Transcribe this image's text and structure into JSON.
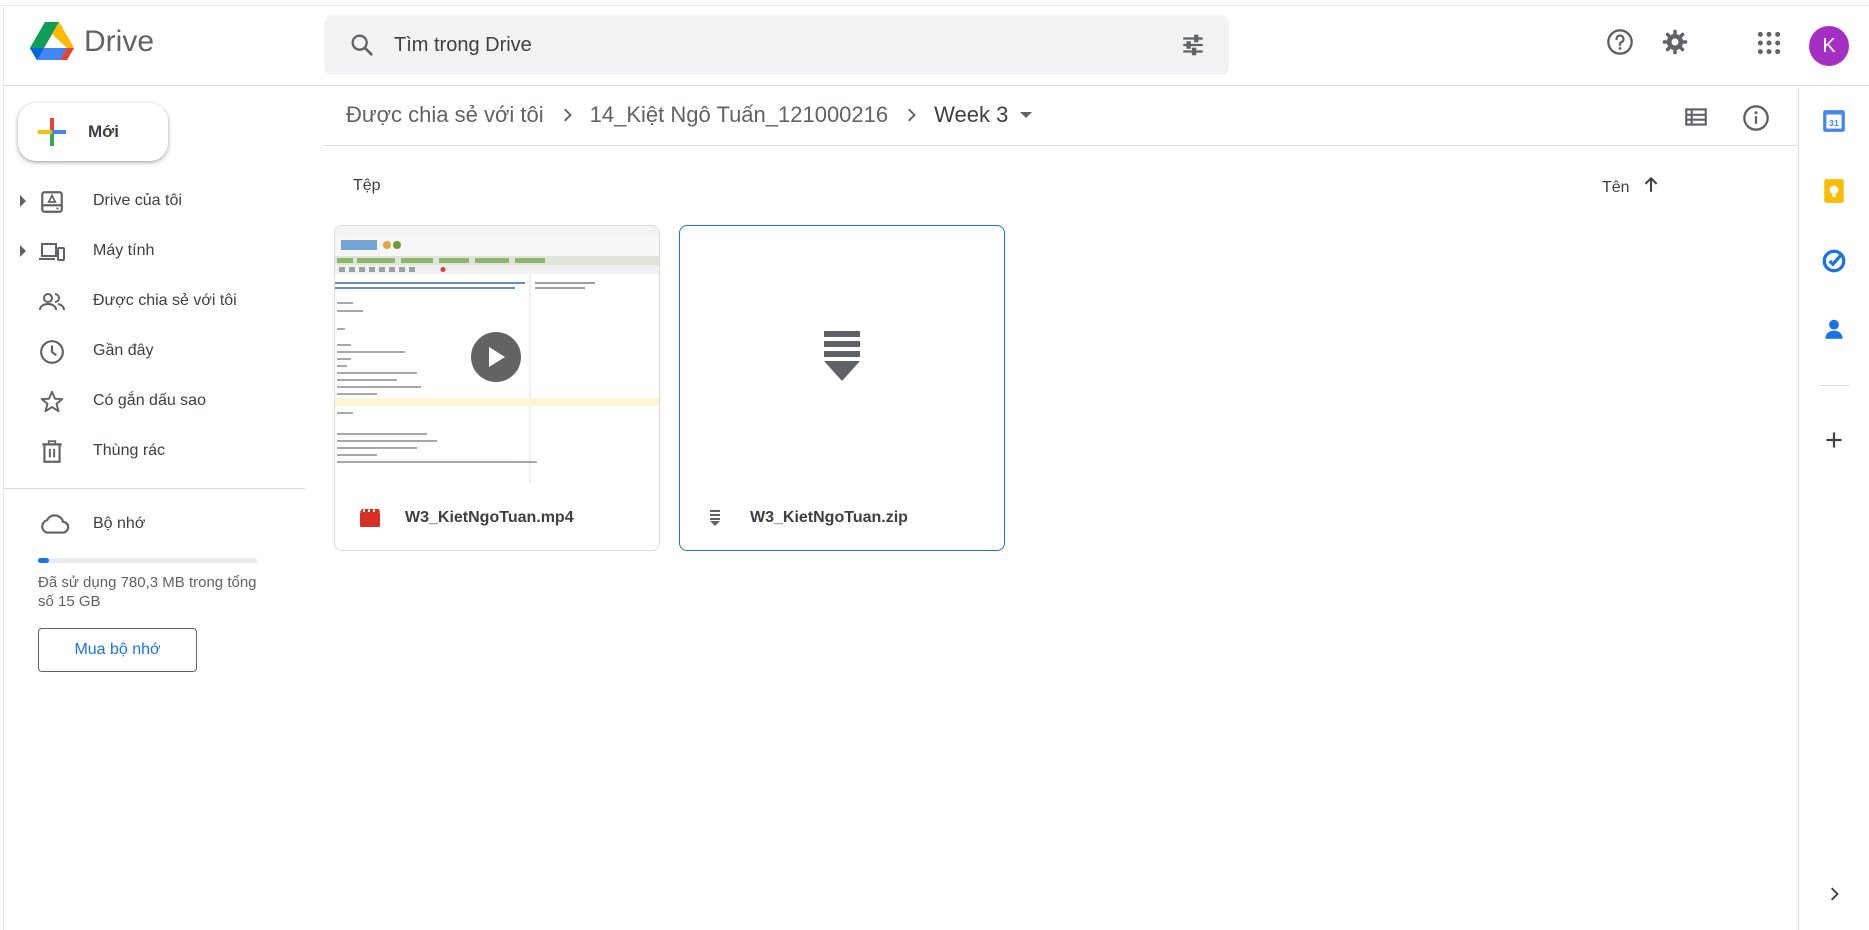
{
  "app": {
    "name": "Drive"
  },
  "search": {
    "placeholder": "Tìm trong Drive"
  },
  "header": {
    "avatar_letter": "K",
    "avatar_color": "#a42fc2"
  },
  "sidebar": {
    "new_label": "Mới",
    "items": [
      {
        "label": "Drive của tôi",
        "icon": "my-drive-icon",
        "expandable": true
      },
      {
        "label": "Máy tính",
        "icon": "computers-icon",
        "expandable": true
      },
      {
        "label": "Được chia sẻ với tôi",
        "icon": "shared-people-icon",
        "expandable": false
      },
      {
        "label": "Gần đây",
        "icon": "clock-icon",
        "expandable": false
      },
      {
        "label": "Có gắn dấu sao",
        "icon": "star-icon",
        "expandable": false
      },
      {
        "label": "Thùng rác",
        "icon": "trash-icon",
        "expandable": false
      }
    ],
    "storage": {
      "label": "Bộ nhớ",
      "used_text": "Đã sử dụng 780,3 MB trong tổng số 15 GB",
      "used_fraction": 0.052,
      "buy_label": "Mua bộ nhớ"
    }
  },
  "breadcrumb": {
    "items": [
      "Được chia sẻ với tôi",
      "14_Kiệt Ngô Tuấn_121000216"
    ],
    "current": "Week 3"
  },
  "main": {
    "section_label": "Tệp",
    "sort_label": "Tên",
    "files": [
      {
        "name": "W3_KietNgoTuan.mp4",
        "type": "video",
        "icon": "video-file-icon"
      },
      {
        "name": "W3_KietNgoTuan.zip",
        "type": "archive",
        "icon": "zip-file-icon"
      }
    ]
  },
  "colors": {
    "accent": "#1a73e8",
    "video_icon": "#d93025"
  }
}
